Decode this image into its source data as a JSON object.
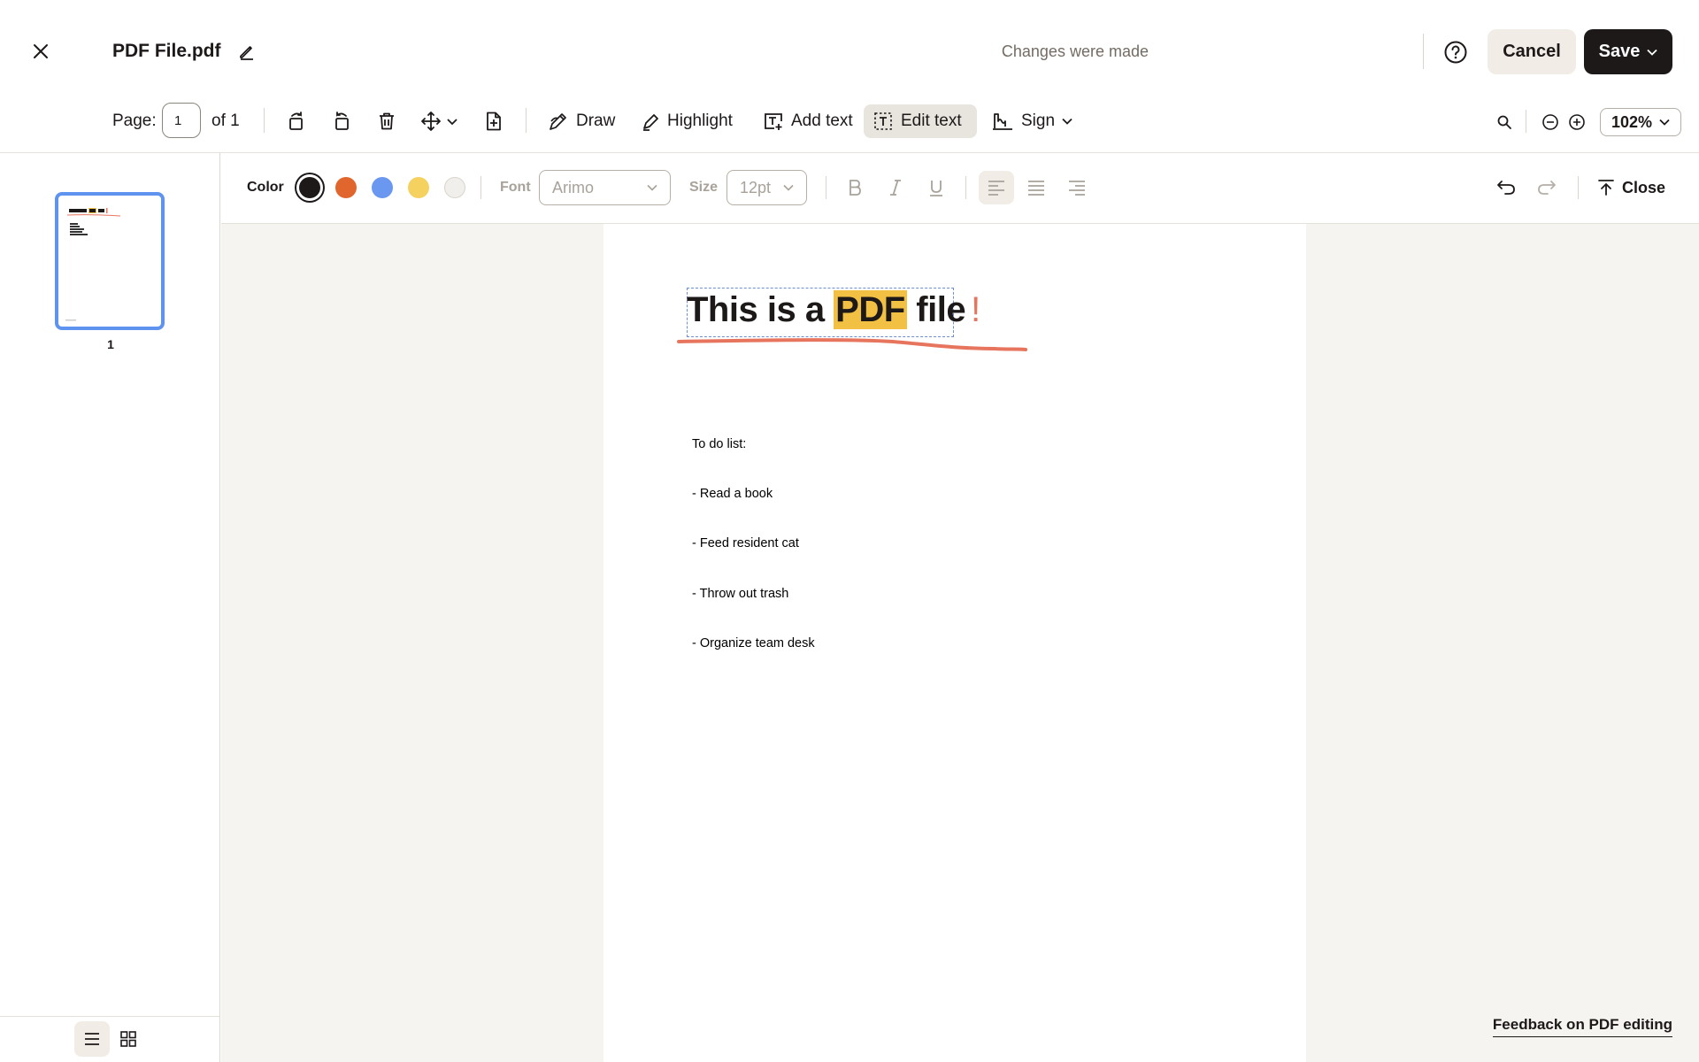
{
  "header": {
    "file_name": "PDF File.pdf",
    "status": "Changes were made",
    "cancel_label": "Cancel",
    "save_label": "Save"
  },
  "toolbar": {
    "page_label": "Page:",
    "page_value": "1",
    "page_total": "of 1",
    "draw_label": "Draw",
    "highlight_label": "Highlight",
    "add_text_label": "Add text",
    "edit_text_label": "Edit text",
    "sign_label": "Sign",
    "zoom": "102%"
  },
  "format_bar": {
    "color_label": "Color",
    "colors": [
      "#1e1919",
      "#e0662e",
      "#6a98f0",
      "#f5d160",
      "#f1efec"
    ],
    "selected_color": 0,
    "font_label": "Font",
    "font_value": "Arimo",
    "size_label": "Size",
    "size_value": "12pt",
    "close_label": "Close"
  },
  "sidebar": {
    "page_number": "1"
  },
  "document": {
    "heading_pre": "This is a ",
    "heading_highlight": "PDF",
    "heading_post": " file",
    "heading_mark": "!",
    "todo_title": "To do list:",
    "todo_items": [
      "- Read a book",
      "- Feed resident cat",
      "- Throw out trash",
      "- Organize team desk"
    ]
  },
  "feedback_label": "Feedback on PDF editing"
}
